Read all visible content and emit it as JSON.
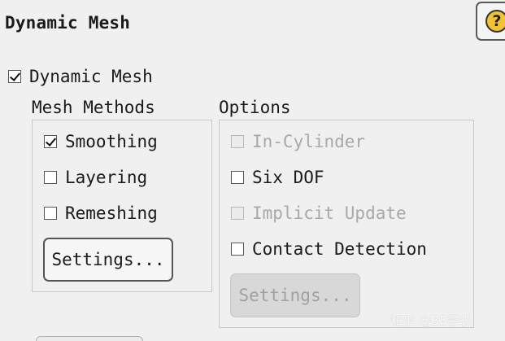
{
  "panel": {
    "title": "Dynamic Mesh",
    "help_icon": "question-mark-icon",
    "help_glyph": "?"
  },
  "dynamic_mesh": {
    "label": "Dynamic Mesh",
    "checked": true
  },
  "mesh_methods": {
    "title": "Mesh Methods",
    "items": [
      {
        "label": "Smoothing",
        "checked": true
      },
      {
        "label": "Layering",
        "checked": false
      },
      {
        "label": "Remeshing",
        "checked": false
      }
    ],
    "settings_label": "Settings..."
  },
  "options": {
    "title": "Options",
    "items": [
      {
        "label": "In-Cylinder",
        "checked": false,
        "enabled": false
      },
      {
        "label": "Six DOF",
        "checked": false,
        "enabled": true
      },
      {
        "label": "Implicit Update",
        "checked": false,
        "enabled": false
      },
      {
        "label": "Contact Detection",
        "checked": false,
        "enabled": true
      }
    ],
    "settings_label": "Settings...",
    "settings_enabled": false
  },
  "watermark": {
    "text": "知乎 @BB学长"
  },
  "colors": {
    "background": "#f0f0f0",
    "help_icon": "#f1c232",
    "disabled_text": "#a8a8a8"
  }
}
